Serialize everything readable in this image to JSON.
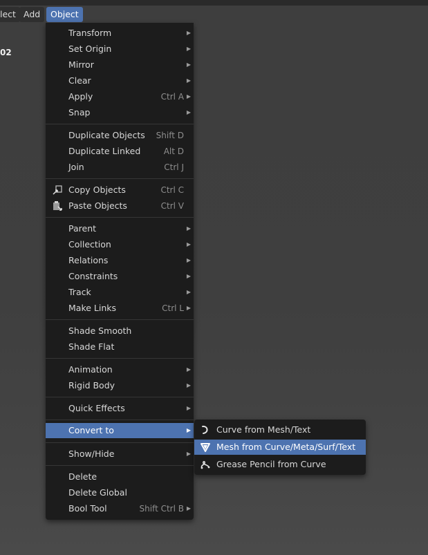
{
  "menubar": {
    "items": [
      {
        "label": "lect"
      },
      {
        "label": "Add"
      },
      {
        "label": "Object"
      }
    ]
  },
  "viewport": {
    "side_label": "02"
  },
  "object_menu": {
    "items": [
      {
        "label": "Transform",
        "shortcut": "",
        "submenu": true
      },
      {
        "label": "Set Origin",
        "shortcut": "",
        "submenu": true
      },
      {
        "label": "Mirror",
        "shortcut": "",
        "submenu": true
      },
      {
        "label": "Clear",
        "shortcut": "",
        "submenu": true
      },
      {
        "label": "Apply",
        "shortcut": "Ctrl A",
        "submenu": true
      },
      {
        "label": "Snap",
        "shortcut": "",
        "submenu": true
      },
      {
        "label": "Duplicate Objects",
        "shortcut": "Shift D",
        "submenu": false
      },
      {
        "label": "Duplicate Linked",
        "shortcut": "Alt D",
        "submenu": false
      },
      {
        "label": "Join",
        "shortcut": "Ctrl J",
        "submenu": false
      },
      {
        "label": "Copy Objects",
        "shortcut": "Ctrl C",
        "submenu": false,
        "icon": "copy-icon"
      },
      {
        "label": "Paste Objects",
        "shortcut": "Ctrl V",
        "submenu": false,
        "icon": "paste-icon"
      },
      {
        "label": "Parent",
        "shortcut": "",
        "submenu": true
      },
      {
        "label": "Collection",
        "shortcut": "",
        "submenu": true
      },
      {
        "label": "Relations",
        "shortcut": "",
        "submenu": true
      },
      {
        "label": "Constraints",
        "shortcut": "",
        "submenu": true
      },
      {
        "label": "Track",
        "shortcut": "",
        "submenu": true
      },
      {
        "label": "Make Links",
        "shortcut": "Ctrl L",
        "submenu": true
      },
      {
        "label": "Shade Smooth",
        "shortcut": "",
        "submenu": false
      },
      {
        "label": "Shade Flat",
        "shortcut": "",
        "submenu": false
      },
      {
        "label": "Animation",
        "shortcut": "",
        "submenu": true
      },
      {
        "label": "Rigid Body",
        "shortcut": "",
        "submenu": true
      },
      {
        "label": "Quick Effects",
        "shortcut": "",
        "submenu": true
      },
      {
        "label": "Convert to",
        "shortcut": "",
        "submenu": true,
        "active": true
      },
      {
        "label": "Show/Hide",
        "shortcut": "",
        "submenu": true
      },
      {
        "label": "Delete",
        "shortcut": "",
        "submenu": false
      },
      {
        "label": "Delete Global",
        "shortcut": "",
        "submenu": false
      },
      {
        "label": "Bool Tool",
        "shortcut": "Shift Ctrl B",
        "submenu": true
      }
    ]
  },
  "convert_submenu": {
    "items": [
      {
        "label": "Curve from Mesh/Text",
        "icon": "curve-icon"
      },
      {
        "label": "Mesh from Curve/Meta/Surf/Text",
        "icon": "mesh-icon",
        "active": true
      },
      {
        "label": "Grease Pencil from Curve",
        "icon": "grease-pencil-icon"
      }
    ]
  },
  "colors": {
    "highlight": "#4d73b0",
    "menu_bg": "#1c1c1c",
    "viewport_bg": "#3f3f3f"
  }
}
